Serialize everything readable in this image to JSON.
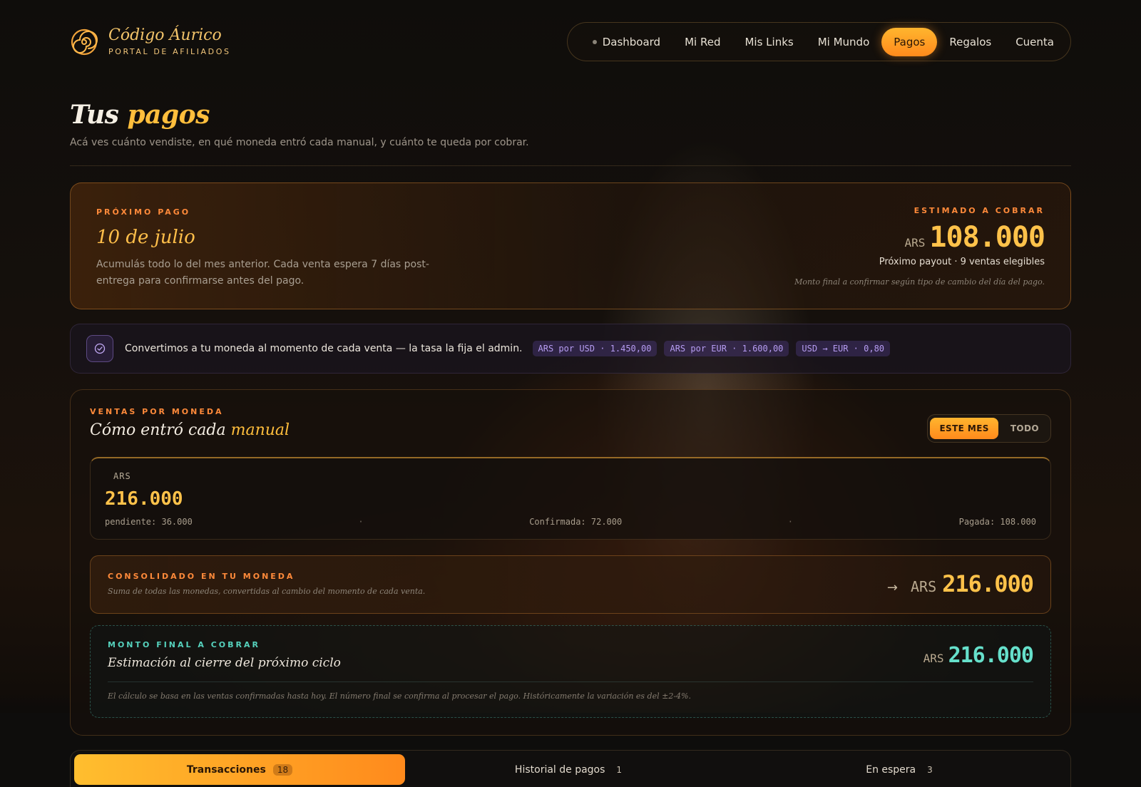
{
  "brand": {
    "name": "Código Áurico",
    "subtitle": "PORTAL DE AFILIADOS"
  },
  "nav": {
    "items": [
      {
        "label": "Dashboard"
      },
      {
        "label": "Mi Red"
      },
      {
        "label": "Mis Links"
      },
      {
        "label": "Mi Mundo"
      },
      {
        "label": "Pagos",
        "active": true
      },
      {
        "label": "Regalos"
      },
      {
        "label": "Cuenta"
      }
    ]
  },
  "page": {
    "title_prefix": "Tus",
    "title_accent": "pagos",
    "subtitle": "Acá ves cuánto vendiste, en qué moneda entró cada manual, y cuánto te queda por cobrar."
  },
  "next_payment": {
    "eyebrow": "PRÓXIMO PAGO",
    "date": "10 de julio",
    "description": "Acumulás todo lo del mes anterior. Cada venta espera 7 días post-entrega para confirmarse antes del pago.",
    "estimate_label": "ESTIMADO A COBRAR",
    "currency": "ARS",
    "amount": "108.000",
    "meta": "Próximo payout · 9 ventas elegibles",
    "note": "Monto final a confirmar según tipo de cambio del día del pago."
  },
  "rates": {
    "text": "Convertimos a tu moneda al momento de cada venta — la tasa la fija el admin.",
    "chips": [
      "ARS por USD · 1.450,00",
      "ARS por EUR · 1.600,00",
      "USD → EUR · 0,80"
    ]
  },
  "sales": {
    "eyebrow": "VENTAS POR MONEDA",
    "title_prefix": "Cómo entró cada",
    "title_accent": "manual",
    "toggle": {
      "this_month": "ESTE MES",
      "all": "TODO",
      "selected": "ESTE MES"
    },
    "currency_card": {
      "code": "ARS",
      "total": "216.000",
      "pending": "pendiente: 36.000",
      "confirmed": "Confirmada: 72.000",
      "paid": "Pagada: 108.000"
    },
    "consolidated": {
      "eyebrow": "CONSOLIDADO EN TU MONEDA",
      "note": "Suma de todas las monedas, convertidas al cambio del momento de cada venta.",
      "currency": "ARS",
      "amount": "216.000"
    },
    "final": {
      "eyebrow": "MONTO FINAL A COBRAR",
      "title": "Estimación al cierre del próximo ciclo",
      "currency": "ARS",
      "amount": "216.000",
      "note": "El cálculo se basa en las ventas confirmadas hasta hoy. El número final se confirma al procesar el pago. Históricamente la variación es del ±2-4%."
    }
  },
  "tabs": [
    {
      "label": "Transacciones",
      "count": "18",
      "active": true
    },
    {
      "label": "Historial de pagos",
      "count": "1"
    },
    {
      "label": "En espera",
      "count": "3"
    }
  ],
  "colors": {
    "accent": "#ffb52e",
    "accent_deep": "#ff8a1c",
    "teal": "#66e0cb",
    "violet": "#b69cf2"
  }
}
